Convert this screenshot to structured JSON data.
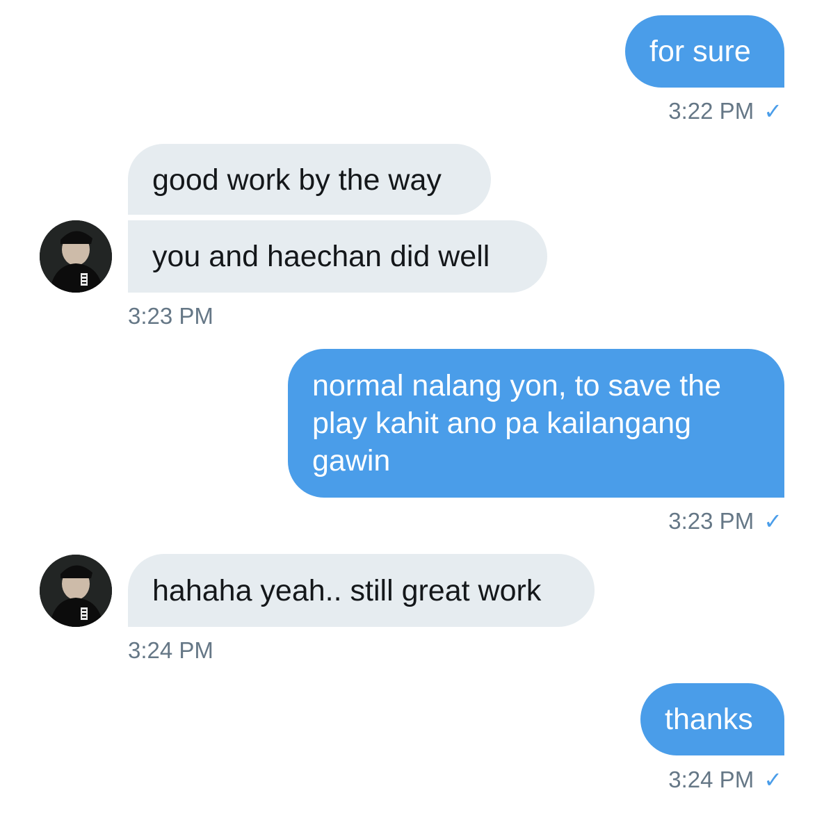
{
  "messages": [
    {
      "id": "m1",
      "direction": "sent",
      "text": "for sure",
      "time": "3:22 PM",
      "read_icon": "checkmark-icon"
    },
    {
      "id": "m2",
      "direction": "received",
      "text": "good work by the way"
    },
    {
      "id": "m3",
      "direction": "received",
      "text": "you and haechan did well",
      "time": "3:23 PM"
    },
    {
      "id": "m4",
      "direction": "sent",
      "lines": [
        "normal nalang yon, to save the",
        "play kahit ano pa kailangang",
        "gawin"
      ],
      "time": "3:23 PM",
      "read_icon": "checkmark-icon"
    },
    {
      "id": "m5",
      "direction": "received",
      "text": "hahaha yeah.. still great work",
      "time": "3:24 PM"
    },
    {
      "id": "m6",
      "direction": "sent",
      "text": "thanks",
      "time": "3:24 PM",
      "read_icon": "checkmark-icon"
    }
  ],
  "checkmark": "✓",
  "colors": {
    "sent_bubble": "#4a9de9",
    "received_bubble": "#e6ecf0",
    "timestamp": "#657786",
    "received_text": "#14171a"
  }
}
